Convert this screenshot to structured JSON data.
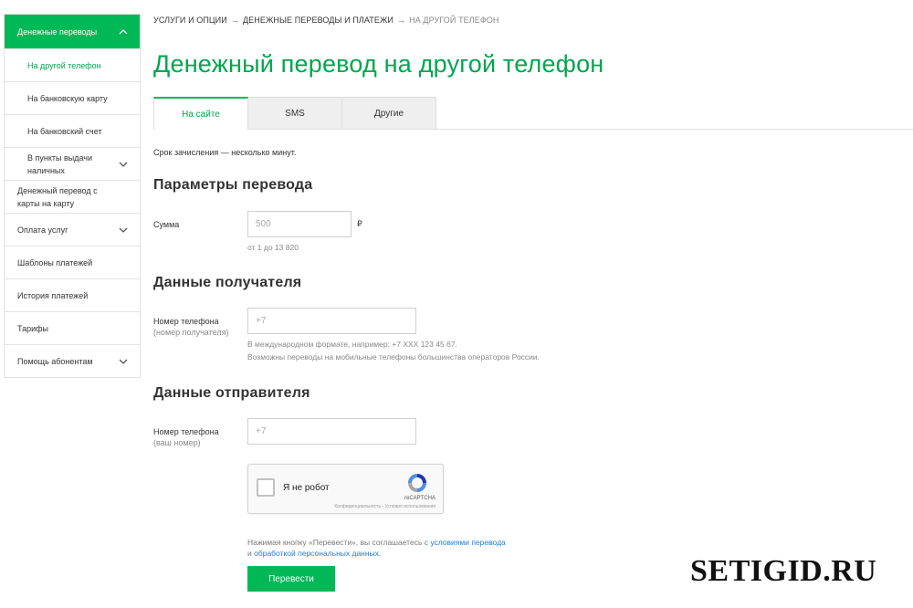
{
  "sidebar": {
    "active_group": "Денежные переводы",
    "sub_items": [
      "На другой телефон",
      "На банковскую карту",
      "На банковский счет",
      "В пункты выдачи наличных"
    ],
    "items": [
      "Денежный перевод с карты на карту",
      "Оплата услуг",
      "Шаблоны платежей",
      "История платежей",
      "Тарифы",
      "Помощь абонентам"
    ]
  },
  "breadcrumb": {
    "items": [
      "УСЛУГИ И ОПЦИИ",
      "ДЕНЕЖНЫЕ ПЕРЕВОДЫ И ПЛАТЕЖИ",
      "НА ДРУГОЙ ТЕЛЕФОН"
    ],
    "separator": "→"
  },
  "page_title": "Денежный перевод на другой телефон",
  "tabs": [
    "На сайте",
    "SMS",
    "Другие"
  ],
  "note": "Срок зачисления — несколько минут.",
  "params": {
    "title": "Параметры перевода",
    "amount_label": "Сумма",
    "amount_placeholder": "500",
    "currency": "₽",
    "amount_hint": "от 1 до 13 820"
  },
  "recipient": {
    "title": "Данные получателя",
    "phone_label": "Номер телефона",
    "phone_sublabel": "(номер получателя)",
    "phone_placeholder": "+7",
    "hint_line1": "В международном формате, например: +7 XXX 123 45 67.",
    "hint_line2": "Возможны переводы на мобильные телефоны большинства операторов России."
  },
  "sender": {
    "title": "Данные отправителя",
    "phone_label": "Номер телефона",
    "phone_sublabel": "(ваш номер)",
    "phone_placeholder": "+7"
  },
  "captcha": {
    "label": "Я не робот",
    "brand": "reCAPTCHA",
    "links": "Конфиденциальность - Условия использования"
  },
  "consent": {
    "text1": "Нажимая кнопку «Перевести», вы соглашаетесь с ",
    "link1": "условиями перевода",
    "text2": "и ",
    "link2": "обработкой персональных данных",
    "text3": "."
  },
  "submit_label": "Перевести",
  "watermark": "SETIGID.RU",
  "colors": {
    "accent": "#00b956",
    "accent_text": "#00a650",
    "link": "#1c7ed6"
  }
}
